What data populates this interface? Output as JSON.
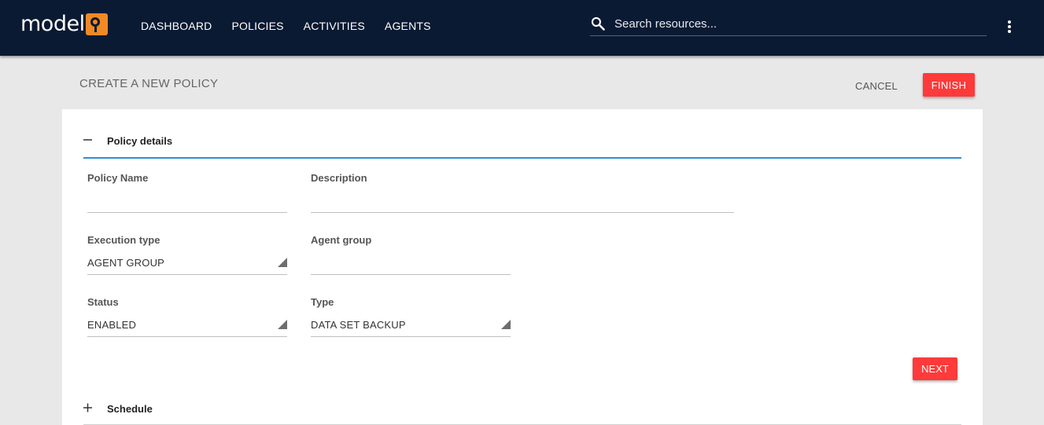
{
  "header": {
    "logo_text": "model",
    "nav": [
      "DASHBOARD",
      "POLICIES",
      "ACTIVITIES",
      "AGENTS"
    ],
    "search_placeholder": "Search resources...",
    "icons": {
      "search": "search-icon",
      "menu": "more-vert-icon"
    }
  },
  "page": {
    "title": "CREATE A NEW POLICY",
    "cancel_label": "CANCEL",
    "finish_label": "FINISH"
  },
  "policy_details": {
    "title": "Policy details",
    "toggle_icon": "collapse-minus-icon",
    "policy_name": {
      "label": "Policy Name",
      "value": ""
    },
    "description": {
      "label": "Description",
      "value": ""
    },
    "execution_type": {
      "label": "Execution type",
      "value": "AGENT GROUP"
    },
    "agent_group": {
      "label": "Agent group",
      "value": ""
    },
    "status": {
      "label": "Status",
      "value": "ENABLED"
    },
    "type": {
      "label": "Type",
      "value": "DATA SET BACKUP"
    },
    "next_label": "NEXT"
  },
  "schedule": {
    "title": "Schedule",
    "toggle_icon": "expand-plus-icon"
  },
  "colors": {
    "topbar": "#0b1a33",
    "accent": "#ff3a3a",
    "section_underline": "#2d8fd6",
    "logo_orange": "#f08a24"
  }
}
